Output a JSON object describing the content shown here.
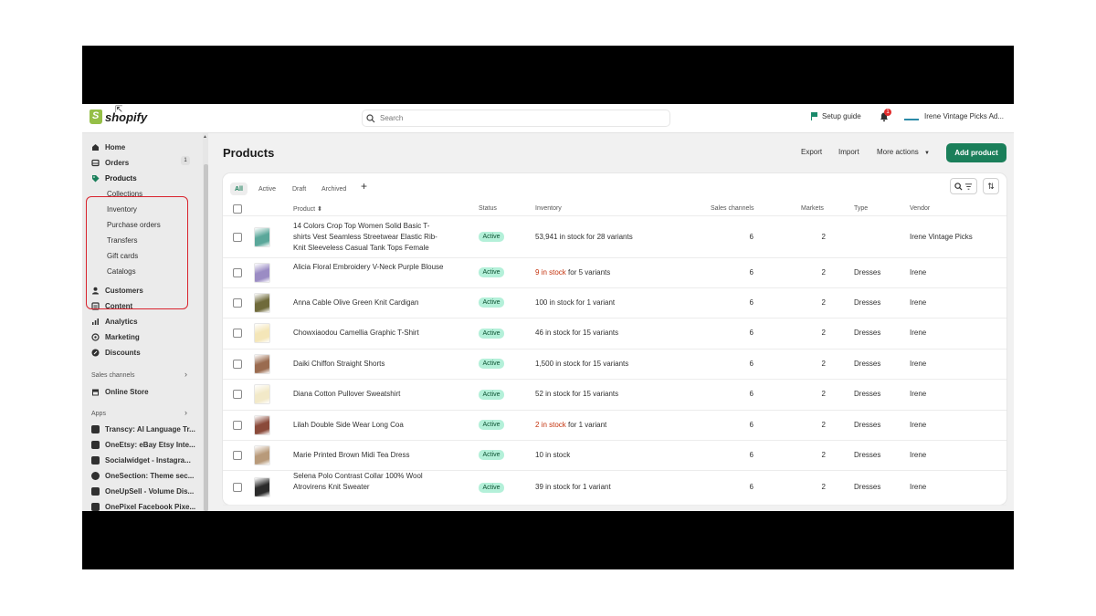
{
  "topbar": {
    "brand": "shopify",
    "search_placeholder": "Search",
    "setup_guide": "Setup guide",
    "notification_count": "1",
    "store_name": "Irene Vintage Picks Ad..."
  },
  "sidebar": {
    "items": [
      {
        "label": "Home",
        "icon": "home-icon"
      },
      {
        "label": "Orders",
        "icon": "orders-icon",
        "badge": "1"
      },
      {
        "label": "Products",
        "icon": "tag-icon"
      }
    ],
    "product_sub": [
      "Collections",
      "Inventory",
      "Purchase orders",
      "Transfers",
      "Gift cards",
      "Catalogs"
    ],
    "items2": [
      {
        "label": "Customers",
        "icon": "person-icon"
      },
      {
        "label": "Content",
        "icon": "content-icon"
      },
      {
        "label": "Analytics",
        "icon": "chart-icon"
      },
      {
        "label": "Marketing",
        "icon": "target-icon"
      },
      {
        "label": "Discounts",
        "icon": "discount-icon"
      }
    ],
    "sales_channels_label": "Sales channels",
    "online_store": "Online Store",
    "apps_label": "Apps",
    "apps": [
      "Transcy: AI Language Tr...",
      "OneEtsy: eBay Etsy Inte...",
      "Socialwidget - Instagra...",
      "OneSection: Theme sec...",
      "OneUpSell - Volume Dis...",
      "OnePixel Facebook Pixe..."
    ]
  },
  "main": {
    "title": "Products",
    "export": "Export",
    "import": "Import",
    "more_actions": "More actions",
    "add_product": "Add product",
    "tabs": [
      "All",
      "Active",
      "Draft",
      "Archived"
    ],
    "columns": {
      "product": "Product",
      "status": "Status",
      "inventory": "Inventory",
      "sales_channels": "Sales channels",
      "markets": "Markets",
      "type": "Type",
      "vendor": "Vendor"
    },
    "rows": [
      {
        "name": "14 Colors Crop Top Women Solid Basic T-shirts Vest Seamless Streetwear Elastic Rib-Knit Sleeveless Casual Tank Tops Female",
        "status": "Active",
        "inv_low": "",
        "inv_rest": "53,941 in stock for 28 variants",
        "channels": "6",
        "markets": "2",
        "type": "",
        "vendor": "Irene Vintage Picks",
        "thumb_color": "#5aa79a"
      },
      {
        "name": "Alicia Floral Embroidery V-Neck Purple Blouse",
        "status": "Active",
        "inv_low": "9 in stock",
        "inv_rest": " for 5 variants",
        "channels": "6",
        "markets": "2",
        "type": "Dresses",
        "vendor": "Irene",
        "thumb_color": "#9b8cc4"
      },
      {
        "name": "Anna Cable Olive Green Knit Cardigan",
        "status": "Active",
        "inv_low": "",
        "inv_rest": "100 in stock for 1 variant",
        "channels": "6",
        "markets": "2",
        "type": "Dresses",
        "vendor": "Irene",
        "thumb_color": "#6f6a3a"
      },
      {
        "name": "Chowxiaodou Camellia Graphic T-Shirt",
        "status": "Active",
        "inv_low": "",
        "inv_rest": "46 in stock for 15 variants",
        "channels": "6",
        "markets": "2",
        "type": "Dresses",
        "vendor": "Irene",
        "thumb_color": "#f4e6b8"
      },
      {
        "name": "Daiki Chiffon Straight Shorts",
        "status": "Active",
        "inv_low": "",
        "inv_rest": "1,500 in stock for 15 variants",
        "channels": "6",
        "markets": "2",
        "type": "Dresses",
        "vendor": "Irene",
        "thumb_color": "#9a6b4f"
      },
      {
        "name": "Diana Cotton Pullover Sweatshirt",
        "status": "Active",
        "inv_low": "",
        "inv_rest": "52 in stock for 15 variants",
        "channels": "6",
        "markets": "2",
        "type": "Dresses",
        "vendor": "Irene",
        "thumb_color": "#f2e9c8"
      },
      {
        "name": "Lilah Double Side Wear Long Coa",
        "status": "Active",
        "inv_low": "2 in stock",
        "inv_rest": " for 1 variant",
        "channels": "6",
        "markets": "2",
        "type": "Dresses",
        "vendor": "Irene",
        "thumb_color": "#8a4a3a"
      },
      {
        "name": "Marie Printed Brown Midi Tea Dress",
        "status": "Active",
        "inv_low": "",
        "inv_rest": "10 in stock",
        "channels": "6",
        "markets": "2",
        "type": "Dresses",
        "vendor": "Irene",
        "thumb_color": "#b89a7a"
      },
      {
        "name": "Selena Polo Contrast Collar 100% Wool Atrovirens Knit Sweater",
        "status": "Active",
        "inv_low": "",
        "inv_rest": "39 in stock for 1 variant",
        "channels": "6",
        "markets": "2",
        "type": "Dresses",
        "vendor": "Irene",
        "thumb_color": "#2b2b2b"
      }
    ]
  }
}
